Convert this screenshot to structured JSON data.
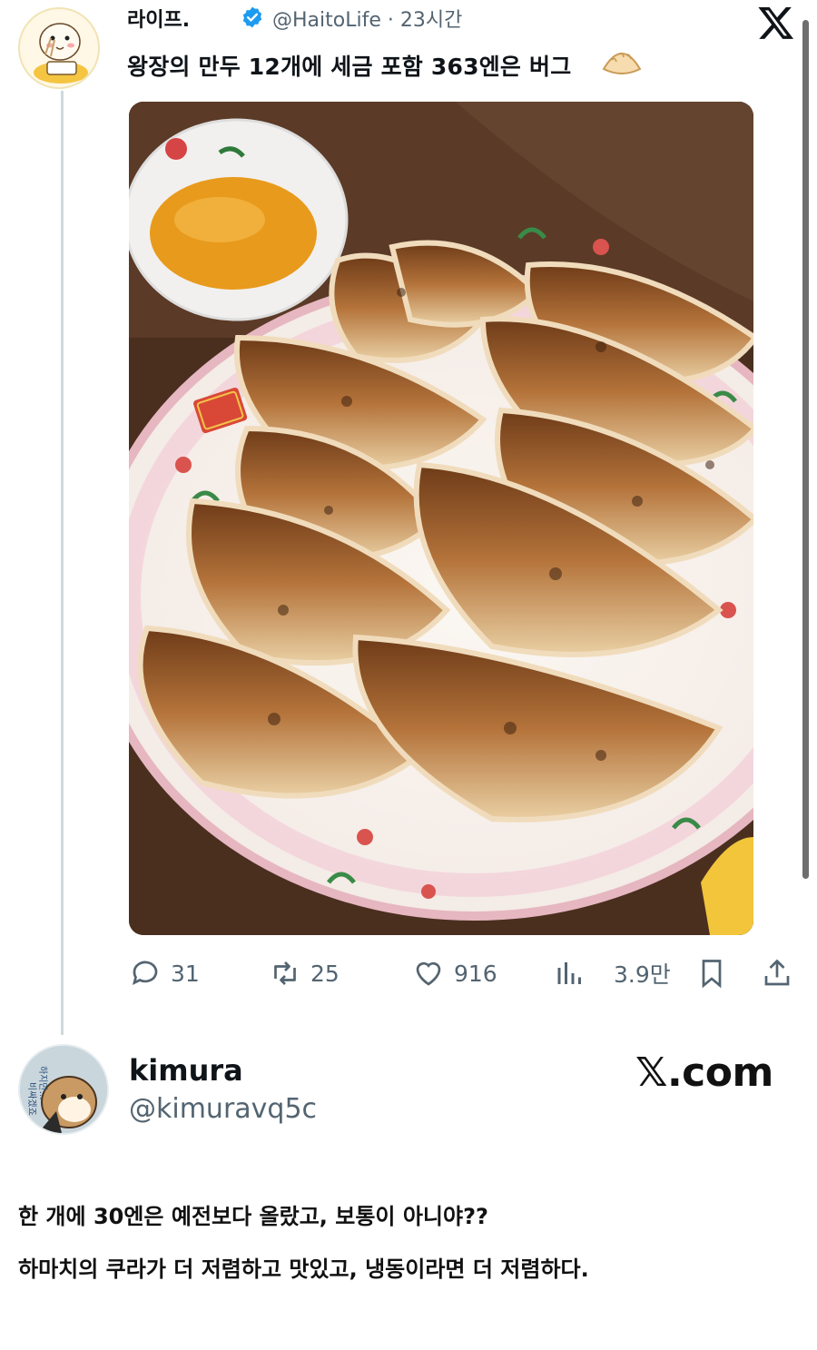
{
  "tweet": {
    "display_name": "라이프.",
    "handle_time": "@HaitoLife · 23시간",
    "text": "왕장의 만두 12개에 세금 포함 363엔은 버그",
    "emoji_icon": "dumpling-icon",
    "photo_caption_alt": "",
    "metrics": {
      "replies": "31",
      "retweets": "25",
      "likes": "916",
      "views": "3.9만"
    }
  },
  "reply": {
    "display_name": "kimura",
    "handle": "@kimuravq5c",
    "brand": "𝕏.com",
    "lines": [
      "한 개에 30엔은 예전보다 올랐고, 보통이 아니야??",
      "하마치의 쿠라가 더 저렴하고 맛있고, 냉동이라면 더 저렴하다."
    ],
    "avatar_text": "하지만… 비싸겠죠"
  },
  "colors": {
    "verified": "#1d9bf0",
    "muted": "#536471",
    "thread_line": "#cfd9de"
  }
}
